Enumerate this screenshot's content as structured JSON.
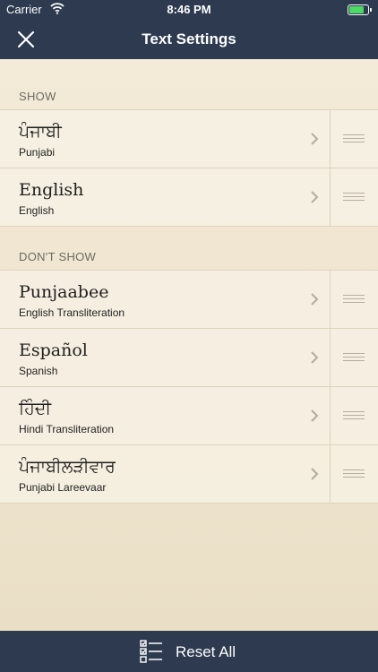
{
  "status": {
    "carrier": "Carrier",
    "time": "8:46 PM",
    "battery_level": 0.9
  },
  "nav": {
    "title": "Text Settings"
  },
  "sections": {
    "show": {
      "header": "SHOW",
      "items": [
        {
          "label": "ਪੰਜਾਬੀ",
          "sub": "Punjabi"
        },
        {
          "label": "English",
          "sub": "English"
        }
      ]
    },
    "dont_show": {
      "header": "DON'T SHOW",
      "items": [
        {
          "label": "Punjaabee",
          "sub": "English Transliteration"
        },
        {
          "label": "Español",
          "sub": "Spanish"
        },
        {
          "label": "ਹਿੰਦੀ",
          "sub": "Hindi Transliteration"
        },
        {
          "label": "ਪੰਜਾਬੀਲੜੀਵਾਰ",
          "sub": "Punjabi Lareevaar"
        }
      ]
    }
  },
  "footer": {
    "reset_label": "Reset All"
  },
  "icons": {
    "close": "close-icon",
    "chevron": "chevron-right-icon",
    "handle": "drag-handle-icon",
    "reset": "checklist-icon",
    "wifi": "wifi-icon",
    "battery": "battery-icon"
  },
  "colors": {
    "bar": "#2d3a4f",
    "battery": "#4cd964",
    "background": "#efe6d2"
  }
}
